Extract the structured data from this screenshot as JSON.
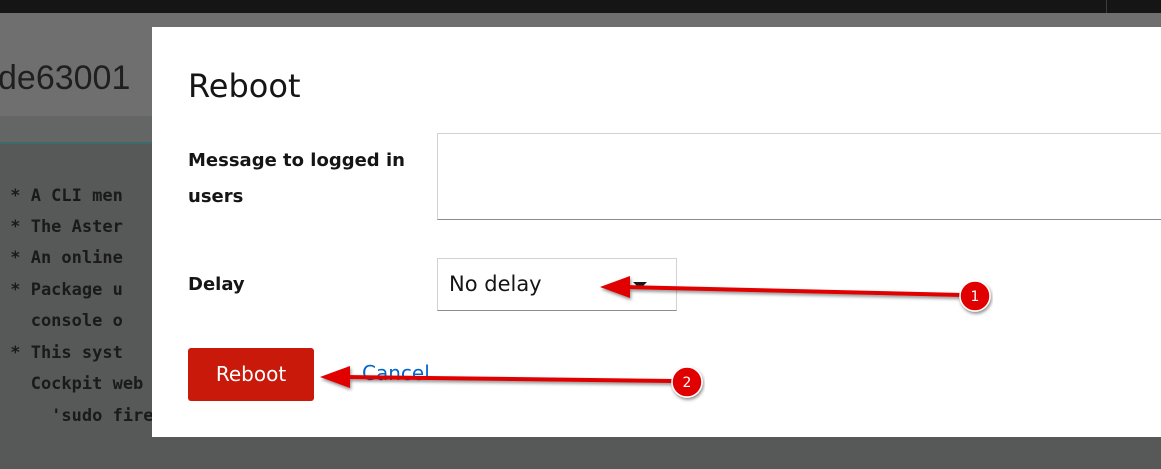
{
  "background": {
    "hostname": "de63001",
    "terminal_lines": [
      " * A CLI men",
      " * The Aster",
      " * An online",
      " * Package u",
      "   console o",
      " * This syst",
      "   Cockpit web console or by using the command:",
      "     'sudo firewall-cmd -p PORT:TYPE'"
    ]
  },
  "dialog": {
    "title": "Reboot",
    "message_label_line1": "Message to logged in",
    "message_label_line2": "users",
    "message_value": "",
    "delay_label": "Delay",
    "delay_value": "No delay",
    "reboot_label": "Reboot",
    "cancel_label": "Cancel"
  },
  "annotations": {
    "color": "#e00000",
    "markers": [
      "1",
      "2"
    ]
  },
  "colors": {
    "danger": "#c9190b",
    "link": "#0066cc",
    "overlay": "#555758"
  },
  "icons": {
    "select_caret": "caret-down-icon"
  }
}
